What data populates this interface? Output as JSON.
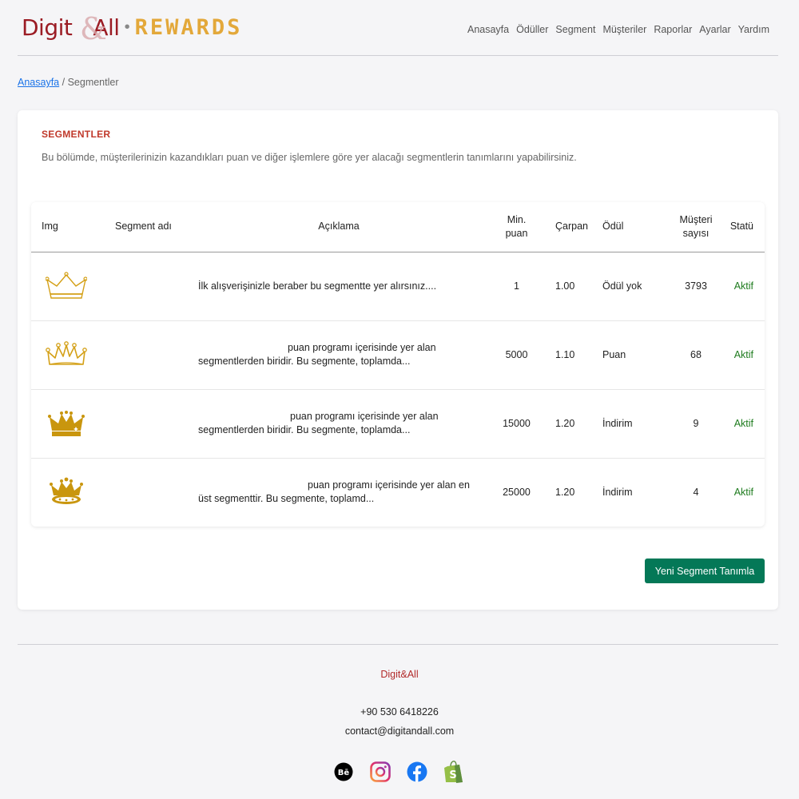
{
  "brand": {
    "logo_digit": "Digit",
    "logo_amp": "&",
    "logo_all": "All",
    "logo_dot": "•",
    "logo_rewards": "REWARDS"
  },
  "nav": [
    "Anasayfa",
    "Ödüller",
    "Segment",
    "Müşteriler",
    "Raporlar",
    "Ayarlar",
    "Yardım"
  ],
  "breadcrumb": {
    "home": "Anasayfa",
    "separator": "/",
    "current": "Segmentler"
  },
  "section": {
    "title": "SEGMENTLER",
    "description": "Bu bölümde, müşterilerinizin kazandıkları puan ve diğer işlemlere göre yer alacağı segmentlerin tanımlarını yapabilirsiniz."
  },
  "table": {
    "headers": {
      "img": "Img",
      "name": "Segment adı",
      "desc": "Açıklama",
      "min_1": "Min.",
      "min_2": "puan",
      "carpan": "Çarpan",
      "odul": "Ödül",
      "count_1": "Müşteri",
      "count_2": "sayısı",
      "status": "Statü"
    },
    "rows": [
      {
        "icon": "crown-outline-icon",
        "name": "",
        "desc_1": "İlk alışverişinizle beraber bu segmentte yer alırsınız....",
        "desc_2": "",
        "min": "1",
        "carpan": "1.00",
        "odul": "Ödül yok",
        "count": "3793",
        "status": "Aktif"
      },
      {
        "icon": "crown-outline-dots-icon",
        "name": "",
        "desc_1": "puan programı içerisinde yer alan",
        "desc_2": "segmentlerden biridir. Bu segmente, toplamda...",
        "min": "5000",
        "carpan": "1.10",
        "odul": "Puan",
        "count": "68",
        "status": "Aktif"
      },
      {
        "icon": "crown-filled-icon",
        "name": "",
        "desc_1": "puan programı içerisinde yer alan",
        "desc_2": "segmentlerden biridir. Bu segmente, toplamda...",
        "min": "15000",
        "carpan": "1.20",
        "odul": "İndirim",
        "count": "9",
        "status": "Aktif"
      },
      {
        "icon": "crown-jeweled-icon",
        "name": "",
        "desc_1": "puan programı içerisinde yer alan en",
        "desc_2": "üst segmenttir. Bu segmente, toplamd...",
        "min": "25000",
        "carpan": "1.20",
        "odul": "İndirim",
        "count": "4",
        "status": "Aktif"
      }
    ]
  },
  "actions": {
    "new_segment": "Yeni Segment Tanımla"
  },
  "footer": {
    "brand": "Digit&All",
    "phone": "+90 530 6418226",
    "email": "contact@digitandall.com",
    "socials": [
      "behance-icon",
      "instagram-icon",
      "facebook-icon",
      "shopify-icon"
    ],
    "behance_text": "Bē"
  },
  "colors": {
    "accent": "#047857",
    "title_red": "#c0392b",
    "status_green": "#1e7b1e",
    "gold": "#d4a017",
    "logo_red": "#9b1c24",
    "logo_gold": "#e3a83a"
  }
}
